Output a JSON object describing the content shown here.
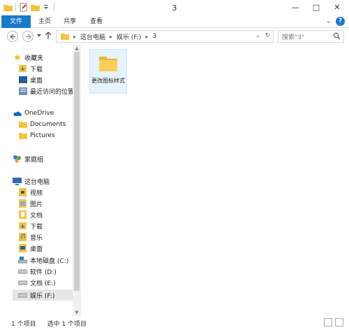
{
  "window": {
    "title": "3",
    "minimize_glyph": "—",
    "maximize_glyph": "□",
    "close_glyph": "✕"
  },
  "ribbon": {
    "tabs": [
      "文件",
      "主页",
      "共享",
      "查看"
    ],
    "expand_glyph": "⌄",
    "help_glyph": "?"
  },
  "address_bar": {
    "segments": [
      "这台电脑",
      "娱乐 (F:)",
      "3"
    ],
    "dropdown_glyph": "⌄",
    "refresh_glyph": "↻"
  },
  "search": {
    "placeholder": "搜索\"3\""
  },
  "nav_pane": {
    "favorites": {
      "label": "收藏夹",
      "items": [
        "下载",
        "桌面",
        "最近访问的位置"
      ]
    },
    "onedrive": {
      "label": "OneDrive",
      "items": [
        "Documents",
        "Pictures"
      ]
    },
    "homegroup": {
      "label": "家庭组"
    },
    "this_pc": {
      "label": "这台电脑",
      "items": [
        "视频",
        "图片",
        "文档",
        "下载",
        "音乐",
        "桌面"
      ],
      "drives": [
        "本地磁盘 (C:)",
        "软件 (D:)",
        "文档 (E:)",
        "娱乐 (F:)"
      ],
      "selected": "娱乐 (F:)"
    }
  },
  "content": {
    "items": [
      {
        "name": "更改图标样式",
        "type": "folder"
      }
    ]
  },
  "status_bar": {
    "item_count": "1 个项目",
    "selected": "选中 1 个项目"
  },
  "colors": {
    "accent": "#1979ca",
    "folder": "#f5c342",
    "selection": "#e5f3fb"
  }
}
